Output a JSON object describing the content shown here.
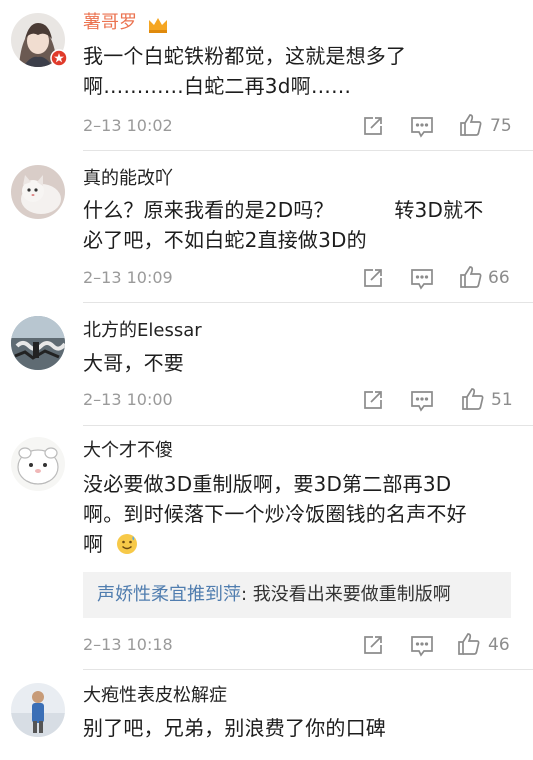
{
  "comments": [
    {
      "username": "薯哥罗",
      "username_color": "#eb7350",
      "text_lines": [
        "我一个白蛇铁粉都觉，这就是想多了",
        "啊…………白蛇二再3d啊……"
      ],
      "timestamp": "2–13 10:02",
      "likes": "75",
      "avatar": "anime-avatar",
      "vip_icon": "crown-icon"
    },
    {
      "username": "真的能改吖",
      "username_color": "#333333",
      "text_lines": [
        "什么？原来我看的是2D吗？　　　转3D就不",
        "必了吧，不如白蛇2直接做3D的"
      ],
      "timestamp": "2–13 10:09",
      "likes": "66",
      "avatar": "cat-avatar"
    },
    {
      "username": "北方的Elessar",
      "username_color": "#333333",
      "text_lines": [
        "大哥，不要"
      ],
      "timestamp": "2–13 10:00",
      "likes": "51",
      "avatar": "street-art-avatar"
    },
    {
      "username": "大个才不傻",
      "username_color": "#333333",
      "text_lines": [
        "没必要做3D重制版啊，要3D第二部再3D",
        "啊。到时候落下一个炒冷饭圈钱的名声不好",
        "啊"
      ],
      "emoji": "sweat-smile-emoji",
      "reply": {
        "name": "声娇性柔宜推到萍",
        "text": ": 我没看出来要做重制版啊"
      },
      "timestamp": "2–13 10:18",
      "likes": "46",
      "avatar": "hamster-avatar"
    },
    {
      "username": "大疱性表皮松解症",
      "username_color": "#333333",
      "text_lines": [
        "别了吧，兄弟，别浪费了你的口碑"
      ],
      "avatar": "figure-avatar"
    }
  ],
  "icons": {
    "share": "share-icon",
    "comment": "comment-icon",
    "like": "thumbs-up-icon"
  }
}
